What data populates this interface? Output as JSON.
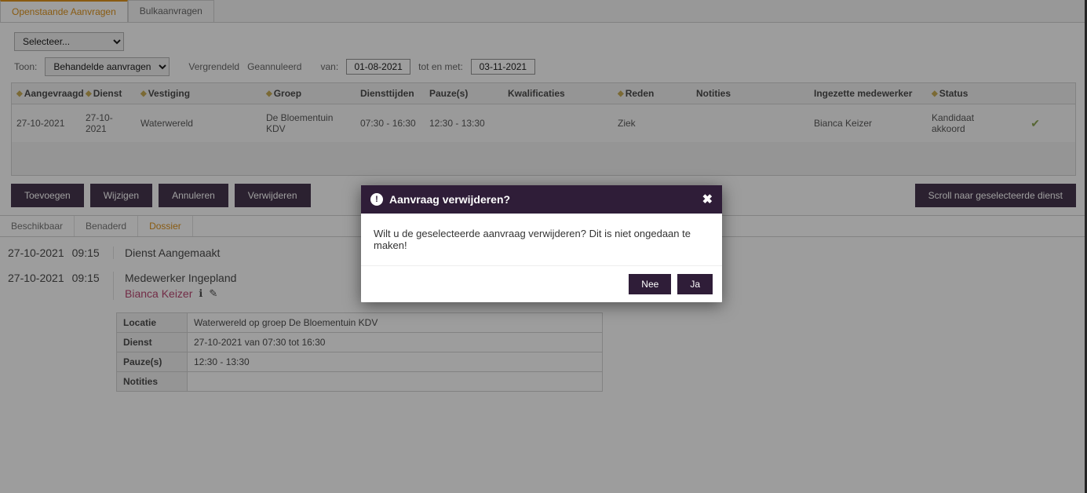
{
  "tabs": {
    "openstaande": "Openstaande Aanvragen",
    "bulk": "Bulkaanvragen"
  },
  "filters": {
    "select_placeholder": "Selecteer...",
    "toon_label": "Toon:",
    "toon_value": "Behandelde aanvragen",
    "vergrendeld": "Vergrendeld",
    "geannuleerd": "Geannuleerd",
    "van_label": "van:",
    "van_value": "01-08-2021",
    "tot_label": "tot en met:",
    "tot_value": "03-11-2021"
  },
  "grid": {
    "headers": {
      "aangevraagd": "Aangevraagd",
      "dienst": "Dienst",
      "vestiging": "Vestiging",
      "groep": "Groep",
      "diensttijden": "Diensttijden",
      "pauze": "Pauze(s)",
      "kwalificaties": "Kwalificaties",
      "reden": "Reden",
      "notities": "Notities",
      "ingezette": "Ingezette medewerker",
      "status": "Status"
    },
    "row": {
      "aangevraagd": "27-10-2021",
      "dienst": "27-10-2021",
      "vestiging": "Waterwereld",
      "groep": "De Bloementuin KDV",
      "diensttijden": "07:30  -  16:30",
      "pauze": "12:30  -  13:30",
      "kwalificaties": "",
      "reden": "Ziek",
      "notities": "",
      "ingezette": "Bianca Keizer",
      "status": "Kandidaat akkoord"
    }
  },
  "actions": {
    "toevoegen": "Toevoegen",
    "wijzigen": "Wijzigen",
    "annuleren": "Annuleren",
    "verwijderen": "Verwijderen",
    "scroll": "Scroll naar geselecteerde dienst"
  },
  "subtabs": {
    "beschikbaar": "Beschikbaar",
    "benaderd": "Benaderd",
    "dossier": "Dossier"
  },
  "dossier": {
    "entry1": {
      "date": "27-10-2021",
      "time": "09:15",
      "title": "Dienst Aangemaakt"
    },
    "entry2": {
      "date": "27-10-2021",
      "time": "09:15",
      "title": "Medewerker Ingepland",
      "worker": "Bianca Keizer"
    },
    "details": {
      "locatie_k": "Locatie",
      "locatie_v": "Waterwereld op groep De Bloementuin KDV",
      "dienst_k": "Dienst",
      "dienst_v": "27-10-2021 van 07:30 tot 16:30",
      "pauze_k": "Pauze(s)",
      "pauze_v": "12:30 - 13:30",
      "notities_k": "Notities",
      "notities_v": ""
    }
  },
  "modal": {
    "title": "Aanvraag verwijderen?",
    "body": "Wilt u de geselecteerde aanvraag verwijderen? Dit is niet ongedaan te maken!",
    "nee": "Nee",
    "ja": "Ja"
  }
}
